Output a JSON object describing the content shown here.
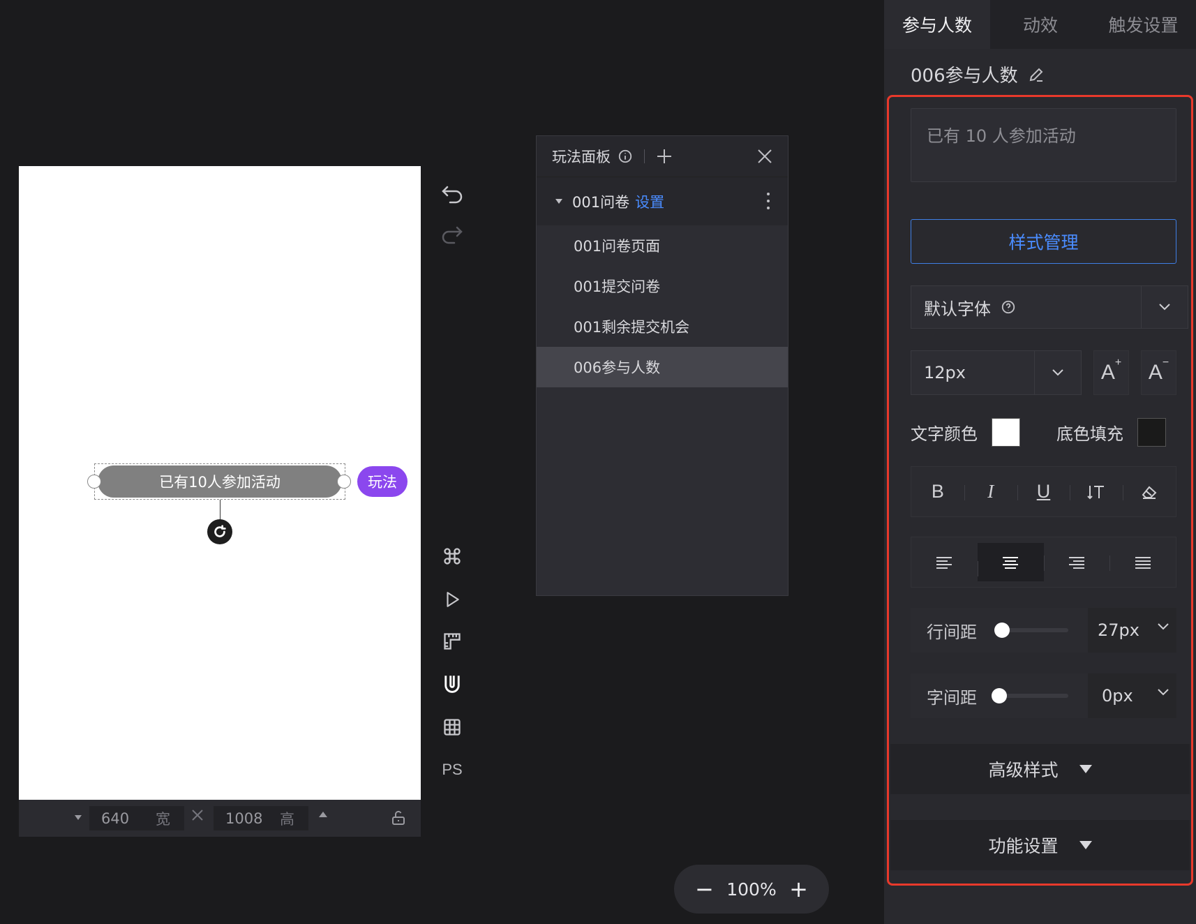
{
  "canvas": {
    "element_text": "已有10人参加活动",
    "play_badge": "玩法",
    "width": "640",
    "width_unit": "宽",
    "height": "1008",
    "height_unit": "高"
  },
  "tools": {
    "ps_label": "PS"
  },
  "play_panel": {
    "title": "玩法面板",
    "group": {
      "name": "001问卷",
      "link": "设置"
    },
    "items": [
      {
        "label": "001问卷页面"
      },
      {
        "label": "001提交问卷"
      },
      {
        "label": "001剩余提交机会"
      },
      {
        "label": "006参与人数"
      }
    ]
  },
  "zoom": {
    "level": "100%",
    "minus": "−",
    "plus": "+"
  },
  "right_panel": {
    "tabs": [
      {
        "label": "参与人数"
      },
      {
        "label": "动效"
      },
      {
        "label": "触发设置"
      }
    ],
    "element_name": "006参与人数",
    "text_content": "已有  10  人参加活动",
    "style_manage": "样式管理",
    "font_family": "默认字体",
    "font_size": "12px",
    "text_color_label": "文字颜色",
    "text_color": "#ffffff",
    "fill_label": "底色填充",
    "fill_color": "#1a1a1a",
    "format": {
      "bold": "B",
      "italic": "I",
      "underline": "U"
    },
    "line_height_label": "行间距",
    "line_height": "27px",
    "letter_spacing_label": "字间距",
    "letter_spacing": "0px",
    "advanced_style": "高级样式",
    "function_settings": "功能设置"
  },
  "colors": {
    "accent": "#4a8cff",
    "badge": "#8b47ee",
    "highlight_border": "#e8392b"
  }
}
